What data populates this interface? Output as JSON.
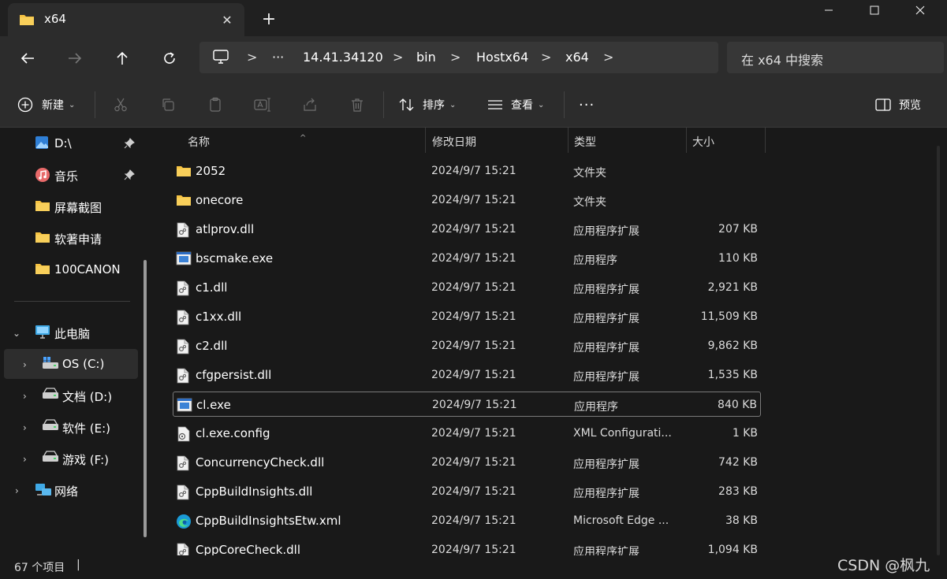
{
  "tab": {
    "title": "x64",
    "close": "✕",
    "new_tab": "+"
  },
  "window": {
    "minimize": "—",
    "maximize": "☐",
    "close": "✕"
  },
  "nav": {
    "back": "←",
    "forward": "→",
    "up": "↑",
    "refresh": "↻"
  },
  "breadcrumb": {
    "more": "···",
    "items": [
      "14.41.34120",
      "bin",
      "Hostx64",
      "x64"
    ],
    "sep": ">"
  },
  "search": {
    "placeholder": "在 x64 中搜索"
  },
  "commands": {
    "new": "新建",
    "sort": "排序",
    "view": "查看",
    "more": "···",
    "preview": "预览"
  },
  "sidebar": {
    "quick": [
      {
        "label": "D:\\",
        "pinned": true
      },
      {
        "label": "音乐",
        "pinned": true
      },
      {
        "label": "屏幕截图"
      },
      {
        "label": "软著申请"
      },
      {
        "label": "100CANON"
      }
    ],
    "this_pc": "此电脑",
    "drives": [
      {
        "label": "OS (C:)",
        "selected": true
      },
      {
        "label": "文档 (D:)"
      },
      {
        "label": "软件 (E:)"
      },
      {
        "label": "游戏 (F:)"
      }
    ],
    "network": "网络"
  },
  "columns": {
    "name": "名称",
    "date": "修改日期",
    "type": "类型",
    "size": "大小"
  },
  "files": [
    {
      "name": "2052",
      "date": "2024/9/7 15:21",
      "type": "文件夹",
      "size": "",
      "icon": "folder"
    },
    {
      "name": "onecore",
      "date": "2024/9/7 15:21",
      "type": "文件夹",
      "size": "",
      "icon": "folder"
    },
    {
      "name": "atlprov.dll",
      "date": "2024/9/7 15:21",
      "type": "应用程序扩展",
      "size": "207 KB",
      "icon": "dll"
    },
    {
      "name": "bscmake.exe",
      "date": "2024/9/7 15:21",
      "type": "应用程序",
      "size": "110 KB",
      "icon": "exe"
    },
    {
      "name": "c1.dll",
      "date": "2024/9/7 15:21",
      "type": "应用程序扩展",
      "size": "2,921 KB",
      "icon": "dll"
    },
    {
      "name": "c1xx.dll",
      "date": "2024/9/7 15:21",
      "type": "应用程序扩展",
      "size": "11,509 KB",
      "icon": "dll"
    },
    {
      "name": "c2.dll",
      "date": "2024/9/7 15:21",
      "type": "应用程序扩展",
      "size": "9,862 KB",
      "icon": "dll"
    },
    {
      "name": "cfgpersist.dll",
      "date": "2024/9/7 15:21",
      "type": "应用程序扩展",
      "size": "1,535 KB",
      "icon": "dll"
    },
    {
      "name": "cl.exe",
      "date": "2024/9/7 15:21",
      "type": "应用程序",
      "size": "840 KB",
      "icon": "exe",
      "focused": true
    },
    {
      "name": "cl.exe.config",
      "date": "2024/9/7 15:21",
      "type": "XML Configurati...",
      "size": "1 KB",
      "icon": "config"
    },
    {
      "name": "ConcurrencyCheck.dll",
      "date": "2024/9/7 15:21",
      "type": "应用程序扩展",
      "size": "742 KB",
      "icon": "dll"
    },
    {
      "name": "CppBuildInsights.dll",
      "date": "2024/9/7 15:21",
      "type": "应用程序扩展",
      "size": "283 KB",
      "icon": "dll"
    },
    {
      "name": "CppBuildInsightsEtw.xml",
      "date": "2024/9/7 15:21",
      "type": "Microsoft Edge ...",
      "size": "38 KB",
      "icon": "edge"
    },
    {
      "name": "CppCoreCheck.dll",
      "date": "2024/9/7 15:21",
      "type": "应用程序扩展",
      "size": "1,094 KB",
      "icon": "dll"
    }
  ],
  "status": {
    "count": "67 个项目",
    "bar": "|"
  },
  "watermark": "CSDN @枫九",
  "colors": {
    "folder": "#f5c242",
    "accent": "#4aa3ff",
    "bg": "#191919",
    "chrome": "#2c2c2c"
  }
}
